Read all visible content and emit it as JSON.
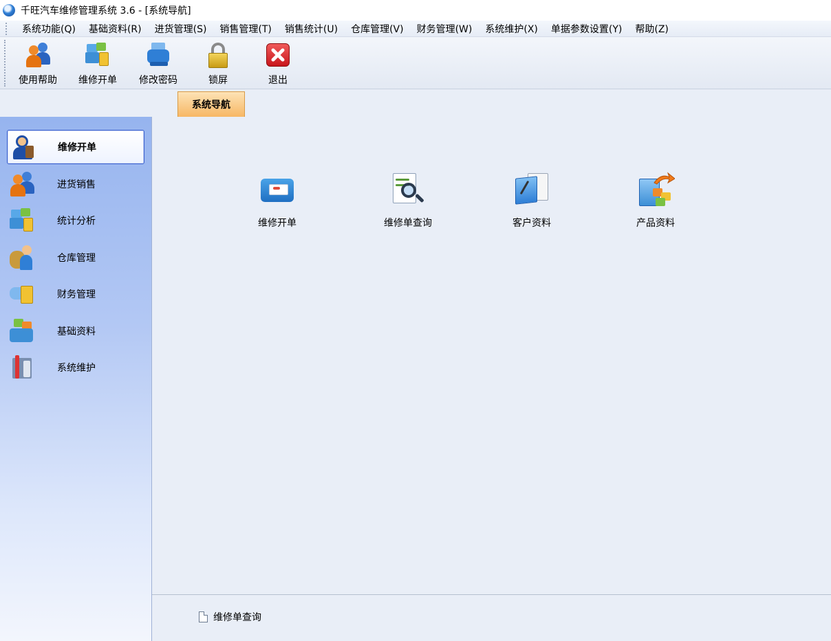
{
  "window": {
    "title": "千旺汽车维修管理系统 3.6 - [系统导航]"
  },
  "menubar": {
    "items": [
      "系统功能(Q)",
      "基础资料(R)",
      "进货管理(S)",
      "销售管理(T)",
      "销售统计(U)",
      "仓库管理(V)",
      "财务管理(W)",
      "系统维护(X)",
      "单据参数设置(Y)",
      "帮助(Z)"
    ]
  },
  "toolbar": {
    "help_label": "使用帮助",
    "repair_order_label": "维修开单",
    "change_password_label": "修改密码",
    "lock_label": "锁屏",
    "exit_label": "退出"
  },
  "tabs": {
    "active_label": "系统导航"
  },
  "sidebar": {
    "items": [
      {
        "label": "维修开单",
        "selected": true
      },
      {
        "label": "进货销售",
        "selected": false
      },
      {
        "label": "统计分析",
        "selected": false
      },
      {
        "label": "仓库管理",
        "selected": false
      },
      {
        "label": "财务管理",
        "selected": false
      },
      {
        "label": "基础资料",
        "selected": false
      },
      {
        "label": "系统维护",
        "selected": false
      }
    ]
  },
  "main": {
    "icons": [
      {
        "label": "维修开单",
        "icon": "repair-order-icon"
      },
      {
        "label": "维修单查询",
        "icon": "order-search-icon"
      },
      {
        "label": "客户资料",
        "icon": "customer-info-icon"
      },
      {
        "label": "产品资料",
        "icon": "product-info-icon"
      }
    ]
  },
  "bottom": {
    "shortcut_label": "维修单查询"
  },
  "colors": {
    "accent_tab": "#f7b765",
    "sidebar_top": "#96b4ef",
    "selected_border": "#3a5fcd"
  }
}
